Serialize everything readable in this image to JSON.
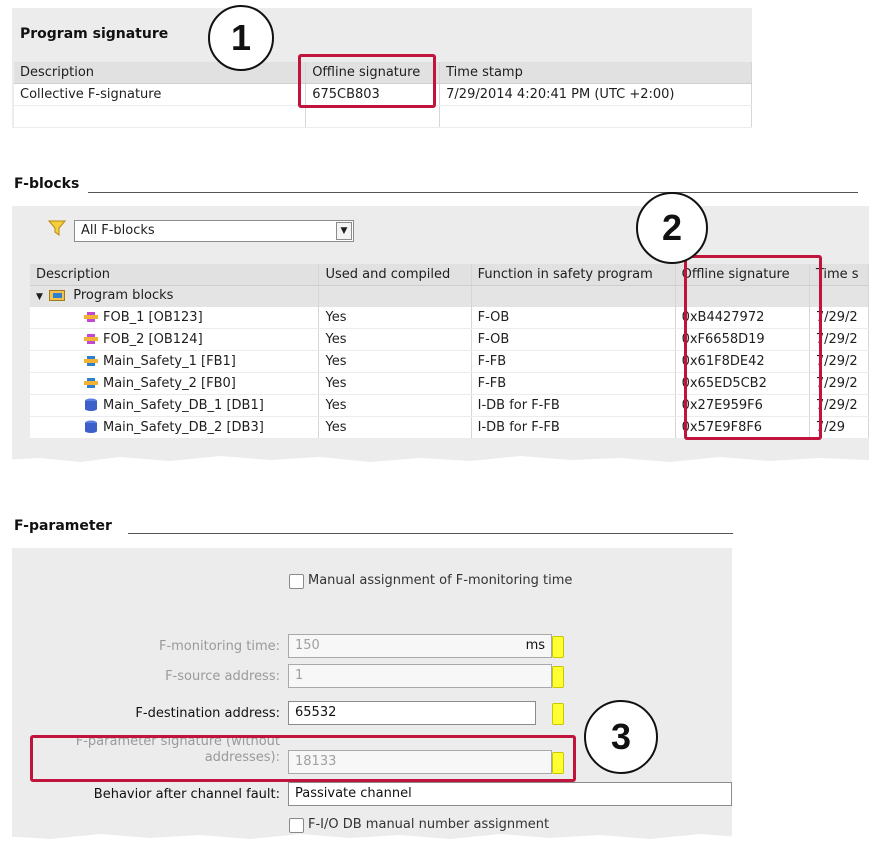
{
  "program_signature": {
    "title": "Program signature",
    "columns": [
      "Description",
      "Offline signature",
      "Time stamp"
    ],
    "rows": [
      {
        "description": "Collective F-signature",
        "offline_signature": "675CB803",
        "time_stamp": "7/29/2014 4:20:41 PM (UTC +2:00)"
      }
    ]
  },
  "fblocks": {
    "title": "F-blocks",
    "filter_value": "All F-blocks",
    "columns": [
      "Description",
      "Used and compiled",
      "Function in safety program",
      "Offline signature",
      "Time s"
    ],
    "group_label": "Program blocks",
    "rows": [
      {
        "name": "FOB_1 [OB123]",
        "used": "Yes",
        "function": "F-OB",
        "signature": "0xB4427972",
        "time": "7/29/2",
        "icon": "ob-block-icon"
      },
      {
        "name": "FOB_2 [OB124]",
        "used": "Yes",
        "function": "F-OB",
        "signature": "0xF6658D19",
        "time": "7/29/2",
        "icon": "ob-block-icon"
      },
      {
        "name": "Main_Safety_1 [FB1]",
        "used": "Yes",
        "function": "F-FB",
        "signature": "0x61F8DE42",
        "time": "7/29/2",
        "icon": "fb-block-icon"
      },
      {
        "name": "Main_Safety_2 [FB0]",
        "used": "Yes",
        "function": "F-FB",
        "signature": "0x65ED5CB2",
        "time": "7/29/2",
        "icon": "fb-block-icon"
      },
      {
        "name": "Main_Safety_DB_1 [DB1]",
        "used": "Yes",
        "function": "I-DB for F-FB",
        "signature": "0x27E959F6",
        "time": "7/29/2",
        "icon": "db-block-icon"
      },
      {
        "name": "Main_Safety_DB_2 [DB3]",
        "used": "Yes",
        "function": "I-DB for F-FB",
        "signature": "0x57E9F8F6",
        "time": "7/29",
        "icon": "db-block-icon"
      }
    ]
  },
  "fparameter": {
    "title": "F-parameter",
    "manual_monitoring_label": "Manual assignment of F-monitoring time",
    "monitoring_time_label": "F-monitoring time:",
    "monitoring_time_value": "150",
    "monitoring_time_unit": "ms",
    "source_address_label": "F-source address:",
    "source_address_value": "1",
    "destination_address_label": "F-destination address:",
    "destination_address_value": "65532",
    "signature_label_line1": "F-parameter signature (without",
    "signature_label_line2": "addresses):",
    "signature_value": "18133",
    "behavior_label": "Behavior after channel fault:",
    "behavior_value": "Passivate channel",
    "manual_db_label": "F-I/O DB manual number assignment"
  },
  "callouts": [
    "1",
    "2",
    "3"
  ],
  "colors": {
    "callout_frame": "#c0143c",
    "status_yellow": "#ffff33",
    "panel_gray": "#ececec"
  }
}
